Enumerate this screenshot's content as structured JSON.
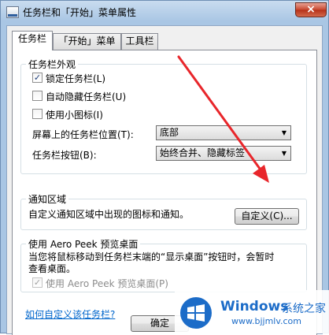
{
  "window": {
    "title": "任务栏和「开始」菜单属性",
    "close_symbol": "×"
  },
  "tabs": [
    {
      "label": "任务栏",
      "active": true
    },
    {
      "label": "「开始」菜单",
      "active": false
    },
    {
      "label": "工具栏",
      "active": false
    }
  ],
  "appearance": {
    "group_label": "任务栏外观",
    "checkboxes": [
      {
        "label": "锁定任务栏(L)",
        "checked": true,
        "mark": "✓"
      },
      {
        "label": "自动隐藏任务栏(U)",
        "checked": false,
        "mark": ""
      },
      {
        "label": "使用小图标(I)",
        "checked": false,
        "mark": ""
      }
    ],
    "location_label": "屏幕上的任务栏位置(T):",
    "location_value": "底部",
    "buttons_label": "任务栏按钮(B):",
    "buttons_value": "始终合并、隐藏标签"
  },
  "notification": {
    "group_label": "通知区域",
    "description": "自定义通知区域中出现的图标和通知。",
    "customize_button": "自定义(C)..."
  },
  "aero_peek": {
    "group_label": "使用 Aero Peek 预览桌面",
    "description_line1": "当您将鼠标移动到任务栏末端的“显示桌面”按钮时，会暂时",
    "description_line2": "查看桌面。",
    "checkbox_label": "使用 Aero Peek 预览桌面(P)",
    "checkbox_checked": true,
    "checkbox_mark": "✓",
    "checkbox_enabled": false
  },
  "help_link": "如何自定义该任务栏?",
  "footer": {
    "ok_button": "确定"
  },
  "annotation": {
    "color": "#e8262b"
  },
  "watermark": {
    "brand": "Windows",
    "brand_cn": "系统之家",
    "url": "www.bjjmlv.com"
  }
}
